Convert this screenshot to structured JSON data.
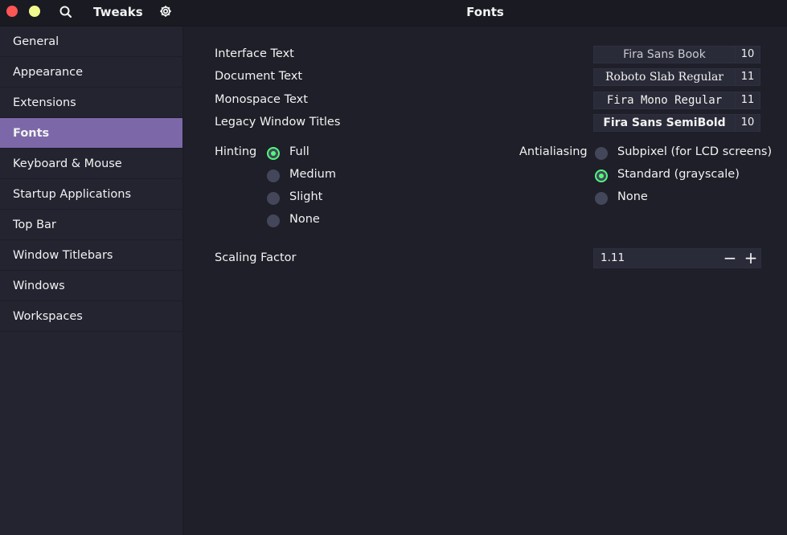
{
  "window": {
    "app_title": "Tweaks",
    "page_title": "Fonts",
    "accent": "#7c68a8",
    "checked_color": "#50fa7b"
  },
  "sidebar": {
    "items": [
      {
        "label": "General"
      },
      {
        "label": "Appearance"
      },
      {
        "label": "Extensions"
      },
      {
        "label": "Fonts",
        "active": true
      },
      {
        "label": "Keyboard & Mouse"
      },
      {
        "label": "Startup Applications"
      },
      {
        "label": "Top Bar"
      },
      {
        "label": "Window Titlebars"
      },
      {
        "label": "Windows"
      },
      {
        "label": "Workspaces"
      }
    ]
  },
  "fonts": {
    "interface": {
      "label": "Interface Text",
      "font": "Fira Sans Book",
      "size": "10"
    },
    "document": {
      "label": "Document Text",
      "font": "Roboto Slab Regular",
      "size": "11"
    },
    "monospace": {
      "label": "Monospace Text",
      "font": "Fira Mono Regular",
      "size": "11"
    },
    "legacy": {
      "label": "Legacy Window Titles",
      "font": "Fira Sans SemiBold",
      "size": "10"
    }
  },
  "hinting": {
    "label": "Hinting",
    "options": [
      "Full",
      "Medium",
      "Slight",
      "None"
    ],
    "selected": "Full"
  },
  "antialiasing": {
    "label": "Antialiasing",
    "options": [
      "Subpixel (for LCD screens)",
      "Standard (grayscale)",
      "None"
    ],
    "selected": "Standard (grayscale)"
  },
  "scaling": {
    "label": "Scaling Factor",
    "value": "1.11",
    "minus": "−",
    "plus": "+"
  }
}
